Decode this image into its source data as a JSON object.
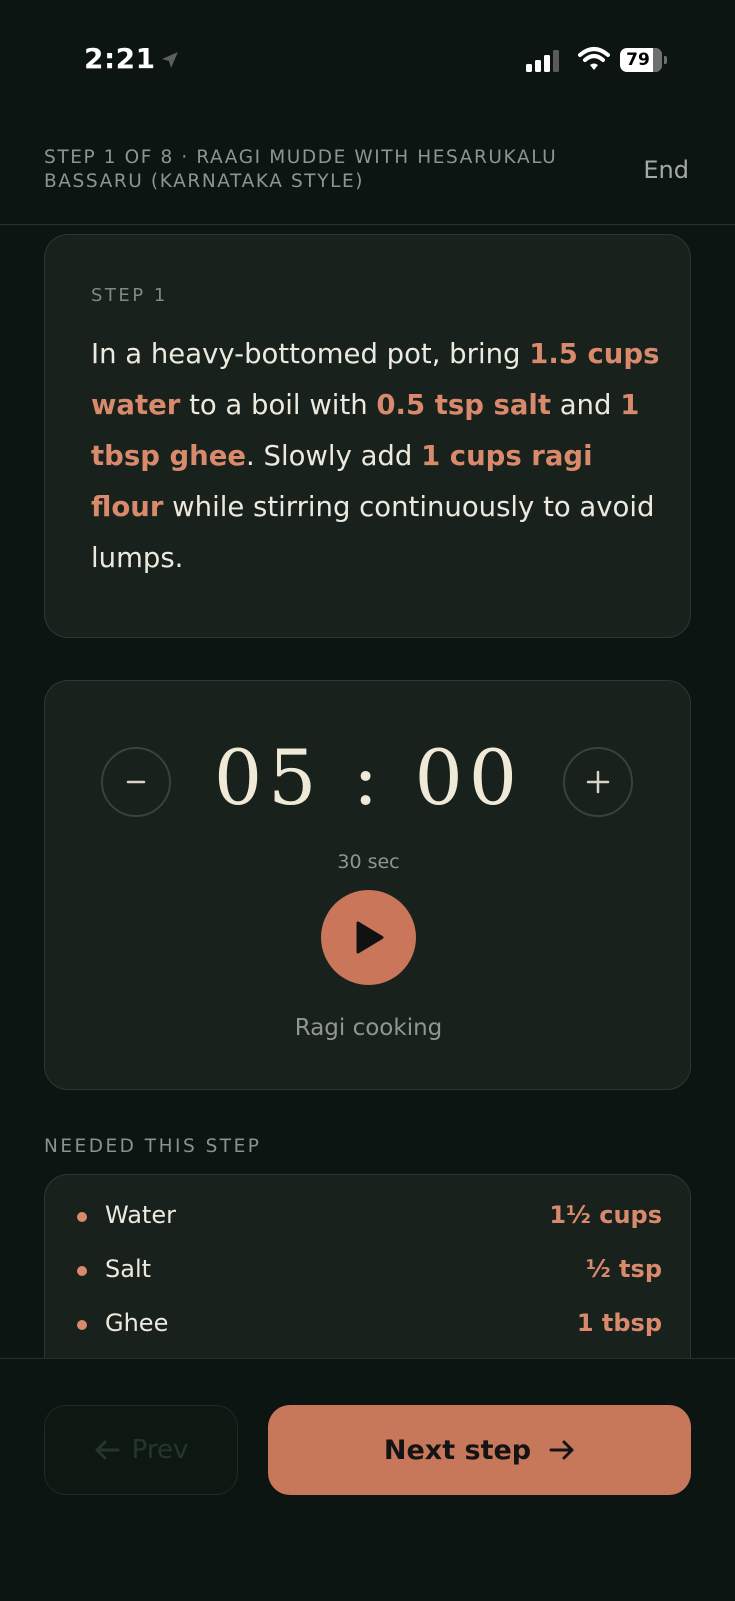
{
  "status_bar": {
    "time": "2:21",
    "battery": "79"
  },
  "header": {
    "title": "STEP 1 OF 8 · RAAGI MUDDE WITH HESARUKALU BASSARU (KARNATAKA STYLE)",
    "end_label": "End"
  },
  "step": {
    "label": "STEP 1",
    "segments": [
      {
        "text": "In a heavy-bottomed pot, bring ",
        "highlight": false
      },
      {
        "text": "1.5 cups water",
        "highlight": true
      },
      {
        "text": " to a boil with ",
        "highlight": false
      },
      {
        "text": "0.5 tsp salt",
        "highlight": true
      },
      {
        "text": " and ",
        "highlight": false
      },
      {
        "text": "1 tbsp ghee",
        "highlight": true
      },
      {
        "text": ". Slowly add ",
        "highlight": false
      },
      {
        "text": "1 cups ragi flour",
        "highlight": true
      },
      {
        "text": " while stirring continuously to avoid lumps.",
        "highlight": false
      }
    ]
  },
  "timer": {
    "display": "05 : 00",
    "increment": "30 sec",
    "label": "Ragi cooking",
    "decrease_icon": "minus-icon",
    "increase_icon": "plus-icon",
    "play_icon": "play-icon"
  },
  "ingredients": {
    "heading": "NEEDED THIS STEP",
    "items": [
      {
        "name": "Water",
        "qty": "1½ cups"
      },
      {
        "name": "Salt",
        "qty": "½ tsp"
      },
      {
        "name": "Ghee",
        "qty": "1 tbsp"
      }
    ]
  },
  "nav": {
    "prev_label": "Prev",
    "next_label": "Next step"
  },
  "colors": {
    "accent": "#c9765a",
    "background": "#0c1511",
    "card": "#18211b"
  }
}
